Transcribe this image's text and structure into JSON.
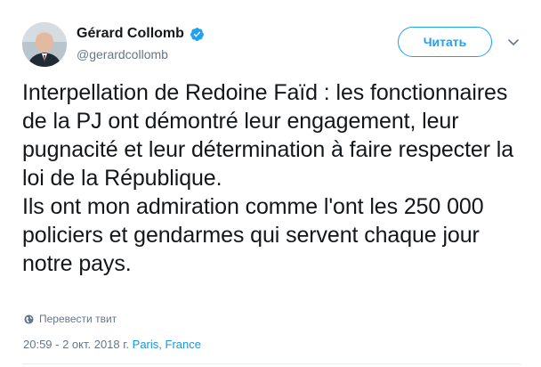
{
  "author": {
    "display_name": "Gérard Collomb",
    "handle": "@gerardcollomb",
    "verified": true
  },
  "follow_button": {
    "label": "Читать"
  },
  "tweet": {
    "text": "Interpellation de Redoine Faïd : les fonctionnaires de la PJ ont démontré leur engagement, leur pugnacité et leur détermination à faire respecter la loi de la République.\nIls ont mon admiration comme l'ont les 250 000 policiers et gendarmes qui servent chaque jour notre pays."
  },
  "translate": {
    "label": "Перевести твит",
    "icon": "globe-icon"
  },
  "meta": {
    "timestamp": "20:59 - 2 окт. 2018 г.",
    "location_city": "Paris",
    "location_separator": ",",
    "location_country": "France"
  },
  "colors": {
    "accent": "#1da1f2",
    "link": "#1b95e0",
    "secondary_text": "#657786",
    "primary_text": "#14171a",
    "divider": "#e6ecf0"
  }
}
